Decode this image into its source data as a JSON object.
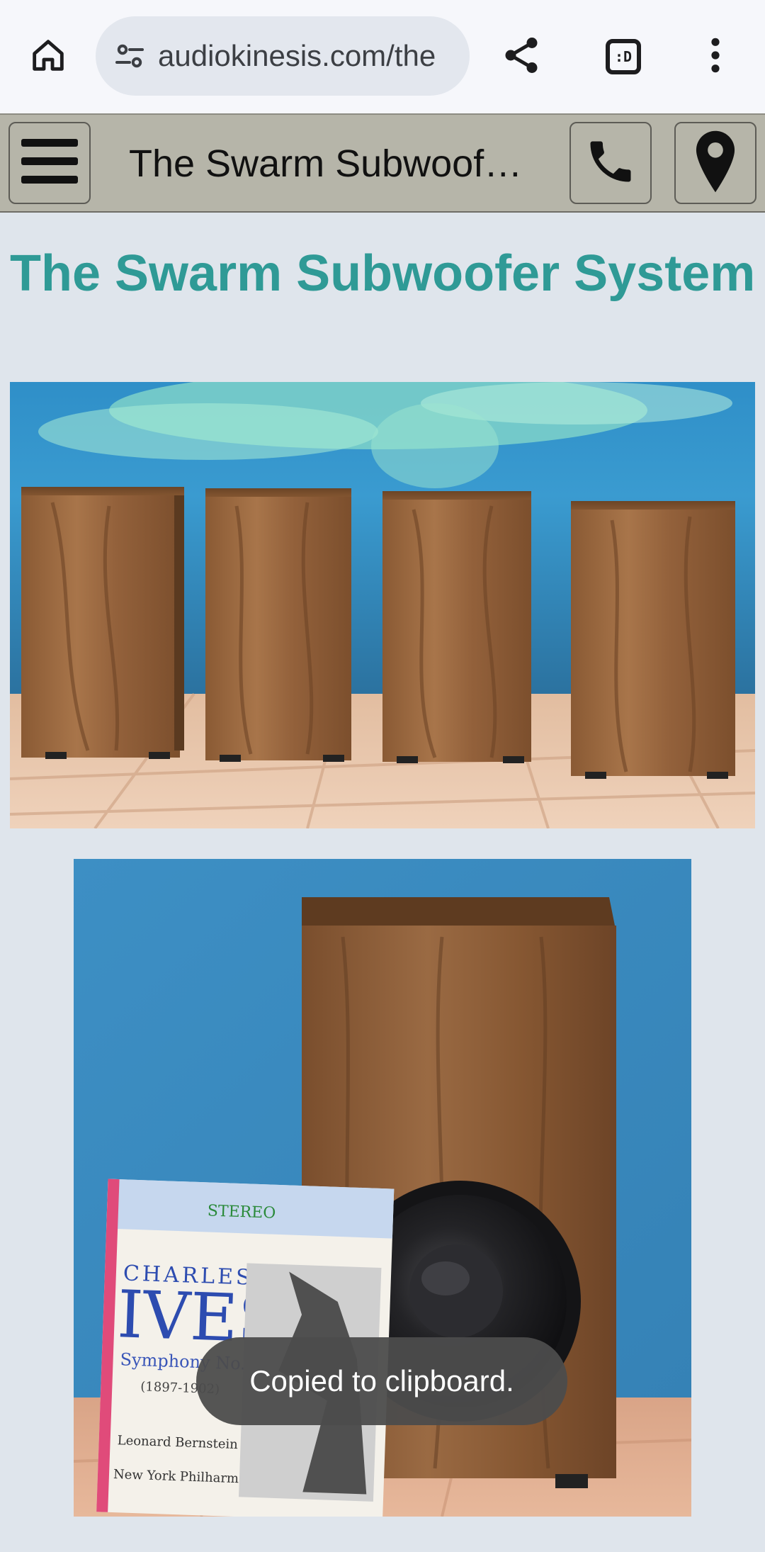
{
  "browser": {
    "url": "audiokinesis.com/the",
    "icons": {
      "home": "home-icon",
      "site_settings": "tune-icon",
      "share": "share-icon",
      "tabs": "tab-switcher-icon",
      "menu": "more-vert-icon"
    },
    "tab_switcher_label": ":D"
  },
  "site_header": {
    "title": "The Swarm Subwoofer System",
    "icons": {
      "menu": "hamburger-icon",
      "phone": "phone-icon",
      "location": "map-pin-icon"
    }
  },
  "content": {
    "heading": "The Swarm Subwoofer System",
    "images": [
      {
        "subject": "four walnut subwoofer cabinets against a blue wall"
      },
      {
        "subject": "single walnut subwoofer with exposed driver beside a record album"
      }
    ],
    "album_cover_text": [
      "STEREO",
      "CHARLES",
      "IVES",
      "Symphony No.",
      "(1897-1902)",
      "Leonard Bernstein",
      "New York Philharmonic"
    ]
  },
  "toast": {
    "message": "Copied to clipboard."
  },
  "colors": {
    "page_background": "#dfe5ec",
    "browser_bar": "#f6f7fb",
    "url_pill": "#e3e7ee",
    "header_bar": "#b6b5a9",
    "heading_accent": "#2f9a96",
    "toast_background": "#4c4c4c"
  }
}
